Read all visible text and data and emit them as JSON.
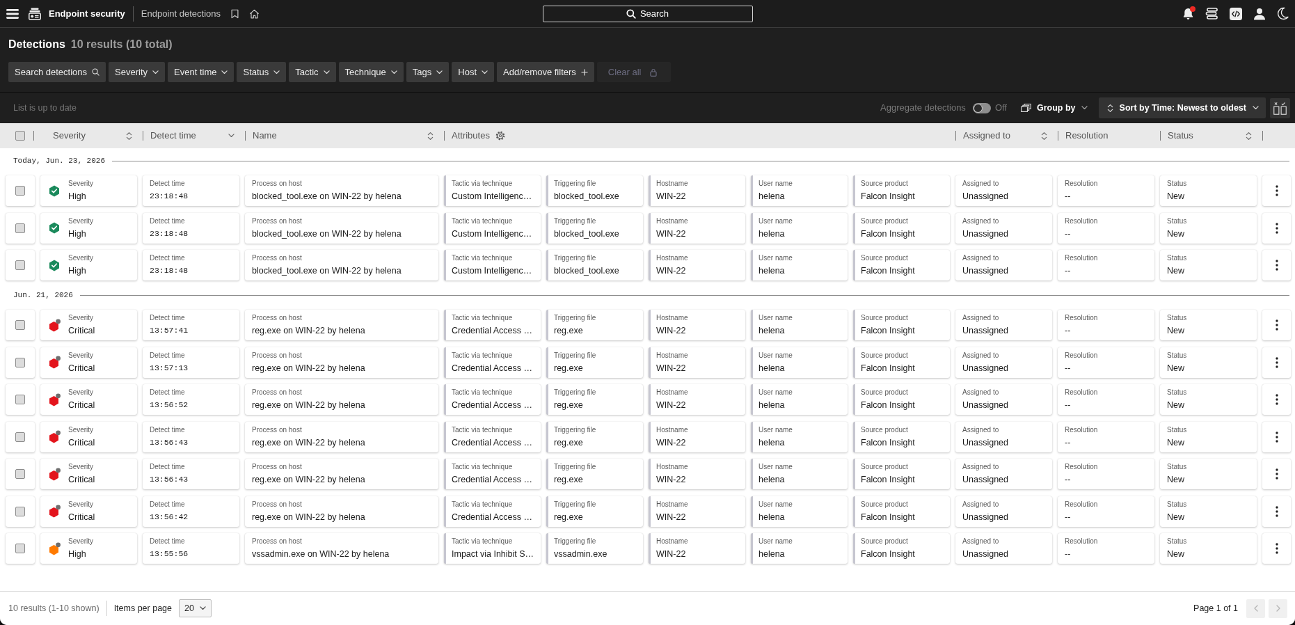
{
  "top_bar": {
    "app_name": "Endpoint security",
    "page_name": "Endpoint detections",
    "search_label": "Search",
    "notifications_unread": true
  },
  "heading": {
    "title": "Detections",
    "count": "10 results (10 total)"
  },
  "filters": [
    {
      "label": "Search detections",
      "kind": "search",
      "disabled": false
    },
    {
      "label": "Severity",
      "kind": "dropdown",
      "disabled": false
    },
    {
      "label": "Event time",
      "kind": "dropdown",
      "disabled": false
    },
    {
      "label": "Status",
      "kind": "dropdown",
      "disabled": false
    },
    {
      "label": "Tactic",
      "kind": "dropdown",
      "disabled": false
    },
    {
      "label": "Technique",
      "kind": "dropdown",
      "disabled": false
    },
    {
      "label": "Tags",
      "kind": "dropdown",
      "disabled": false
    },
    {
      "label": "Host",
      "kind": "dropdown",
      "disabled": false
    },
    {
      "label": "Add/remove filters",
      "kind": "add",
      "disabled": false
    },
    {
      "label": "Clear all",
      "kind": "clear",
      "disabled": true
    }
  ],
  "toolbar": {
    "list_status": "List is up to date",
    "aggregate": {
      "label": "Aggregate detections",
      "on": false,
      "state_text": "Off"
    },
    "group_by": "Group by",
    "sort": "Sort by Time: Newest to oldest"
  },
  "table": {
    "select_all_checked": false,
    "columns": [
      {
        "label": "Severity",
        "kind": "sortable"
      },
      {
        "label": "Detect time",
        "kind": "sorted"
      },
      {
        "label": "Name",
        "kind": "sortable"
      },
      {
        "label": "Attributes",
        "kind": "attributes"
      },
      {
        "label": "Assigned to",
        "kind": "sortable"
      },
      {
        "label": "Resolution",
        "kind": "plain"
      },
      {
        "label": "Status",
        "kind": "sortable"
      }
    ],
    "groups": [
      {
        "date": "Today, Jun. 23, 2026",
        "rows": [
          {
            "selected": false,
            "fields": [
              {
                "kind": "severity",
                "label": "Severity",
                "value": "High",
                "color": "#1b8a5c",
                "prevented": true
              },
              {
                "kind": "time",
                "label": "Detect time",
                "value": "23:18:48"
              },
              {
                "kind": "plain",
                "label": "Process on host",
                "value": "blocked_tool.exe on WIN-22 by helena"
              },
              {
                "kind": "attribute",
                "label": "Tactic via technique",
                "value": "Custom Intelligenc…"
              },
              {
                "kind": "attribute",
                "label": "Triggering file",
                "value": "blocked_tool.exe"
              },
              {
                "kind": "attribute",
                "label": "Hostname",
                "value": "WIN-22"
              },
              {
                "kind": "attribute",
                "label": "User name",
                "value": "helena"
              },
              {
                "kind": "attribute",
                "label": "Source product",
                "value": "Falcon Insight"
              },
              {
                "kind": "plain",
                "label": "Assigned to",
                "value": "Unassigned"
              },
              {
                "kind": "plain",
                "label": "Resolution",
                "value": "--"
              },
              {
                "kind": "plain",
                "label": "Status",
                "value": "New"
              }
            ]
          },
          {
            "selected": false,
            "fields": [
              {
                "kind": "severity",
                "label": "Severity",
                "value": "High",
                "color": "#1b8a5c",
                "prevented": true
              },
              {
                "kind": "time",
                "label": "Detect time",
                "value": "23:18:48"
              },
              {
                "kind": "plain",
                "label": "Process on host",
                "value": "blocked_tool.exe on WIN-22 by helena"
              },
              {
                "kind": "attribute",
                "label": "Tactic via technique",
                "value": "Custom Intelligenc…"
              },
              {
                "kind": "attribute",
                "label": "Triggering file",
                "value": "blocked_tool.exe"
              },
              {
                "kind": "attribute",
                "label": "Hostname",
                "value": "WIN-22"
              },
              {
                "kind": "attribute",
                "label": "User name",
                "value": "helena"
              },
              {
                "kind": "attribute",
                "label": "Source product",
                "value": "Falcon Insight"
              },
              {
                "kind": "plain",
                "label": "Assigned to",
                "value": "Unassigned"
              },
              {
                "kind": "plain",
                "label": "Resolution",
                "value": "--"
              },
              {
                "kind": "plain",
                "label": "Status",
                "value": "New"
              }
            ]
          },
          {
            "selected": false,
            "fields": [
              {
                "kind": "severity",
                "label": "Severity",
                "value": "High",
                "color": "#1b8a5c",
                "prevented": true
              },
              {
                "kind": "time",
                "label": "Detect time",
                "value": "23:18:48"
              },
              {
                "kind": "plain",
                "label": "Process on host",
                "value": "blocked_tool.exe on WIN-22 by helena"
              },
              {
                "kind": "attribute",
                "label": "Tactic via technique",
                "value": "Custom Intelligenc…"
              },
              {
                "kind": "attribute",
                "label": "Triggering file",
                "value": "blocked_tool.exe"
              },
              {
                "kind": "attribute",
                "label": "Hostname",
                "value": "WIN-22"
              },
              {
                "kind": "attribute",
                "label": "User name",
                "value": "helena"
              },
              {
                "kind": "attribute",
                "label": "Source product",
                "value": "Falcon Insight"
              },
              {
                "kind": "plain",
                "label": "Assigned to",
                "value": "Unassigned"
              },
              {
                "kind": "plain",
                "label": "Resolution",
                "value": "--"
              },
              {
                "kind": "plain",
                "label": "Status",
                "value": "New"
              }
            ]
          }
        ]
      },
      {
        "date": "Jun. 21, 2026",
        "rows": [
          {
            "selected": false,
            "fields": [
              {
                "kind": "severity",
                "label": "Severity",
                "value": "Critical",
                "color": "#e3141c",
                "prevented": false
              },
              {
                "kind": "time",
                "label": "Detect time",
                "value": "13:57:41"
              },
              {
                "kind": "plain",
                "label": "Process on host",
                "value": "reg.exe on WIN-22 by helena"
              },
              {
                "kind": "attribute",
                "label": "Tactic via technique",
                "value": "Credential Access …"
              },
              {
                "kind": "attribute",
                "label": "Triggering file",
                "value": "reg.exe"
              },
              {
                "kind": "attribute",
                "label": "Hostname",
                "value": "WIN-22"
              },
              {
                "kind": "attribute",
                "label": "User name",
                "value": "helena"
              },
              {
                "kind": "attribute",
                "label": "Source product",
                "value": "Falcon Insight"
              },
              {
                "kind": "plain",
                "label": "Assigned to",
                "value": "Unassigned"
              },
              {
                "kind": "plain",
                "label": "Resolution",
                "value": "--"
              },
              {
                "kind": "plain",
                "label": "Status",
                "value": "New"
              }
            ]
          },
          {
            "selected": false,
            "fields": [
              {
                "kind": "severity",
                "label": "Severity",
                "value": "Critical",
                "color": "#e3141c",
                "prevented": false
              },
              {
                "kind": "time",
                "label": "Detect time",
                "value": "13:57:13"
              },
              {
                "kind": "plain",
                "label": "Process on host",
                "value": "reg.exe on WIN-22 by helena"
              },
              {
                "kind": "attribute",
                "label": "Tactic via technique",
                "value": "Credential Access …"
              },
              {
                "kind": "attribute",
                "label": "Triggering file",
                "value": "reg.exe"
              },
              {
                "kind": "attribute",
                "label": "Hostname",
                "value": "WIN-22"
              },
              {
                "kind": "attribute",
                "label": "User name",
                "value": "helena"
              },
              {
                "kind": "attribute",
                "label": "Source product",
                "value": "Falcon Insight"
              },
              {
                "kind": "plain",
                "label": "Assigned to",
                "value": "Unassigned"
              },
              {
                "kind": "plain",
                "label": "Resolution",
                "value": "--"
              },
              {
                "kind": "plain",
                "label": "Status",
                "value": "New"
              }
            ]
          },
          {
            "selected": false,
            "fields": [
              {
                "kind": "severity",
                "label": "Severity",
                "value": "Critical",
                "color": "#e3141c",
                "prevented": false
              },
              {
                "kind": "time",
                "label": "Detect time",
                "value": "13:56:52"
              },
              {
                "kind": "plain",
                "label": "Process on host",
                "value": "reg.exe on WIN-22 by helena"
              },
              {
                "kind": "attribute",
                "label": "Tactic via technique",
                "value": "Credential Access …"
              },
              {
                "kind": "attribute",
                "label": "Triggering file",
                "value": "reg.exe"
              },
              {
                "kind": "attribute",
                "label": "Hostname",
                "value": "WIN-22"
              },
              {
                "kind": "attribute",
                "label": "User name",
                "value": "helena"
              },
              {
                "kind": "attribute",
                "label": "Source product",
                "value": "Falcon Insight"
              },
              {
                "kind": "plain",
                "label": "Assigned to",
                "value": "Unassigned"
              },
              {
                "kind": "plain",
                "label": "Resolution",
                "value": "--"
              },
              {
                "kind": "plain",
                "label": "Status",
                "value": "New"
              }
            ]
          },
          {
            "selected": false,
            "fields": [
              {
                "kind": "severity",
                "label": "Severity",
                "value": "Critical",
                "color": "#e3141c",
                "prevented": false
              },
              {
                "kind": "time",
                "label": "Detect time",
                "value": "13:56:43"
              },
              {
                "kind": "plain",
                "label": "Process on host",
                "value": "reg.exe on WIN-22 by helena"
              },
              {
                "kind": "attribute",
                "label": "Tactic via technique",
                "value": "Credential Access …"
              },
              {
                "kind": "attribute",
                "label": "Triggering file",
                "value": "reg.exe"
              },
              {
                "kind": "attribute",
                "label": "Hostname",
                "value": "WIN-22"
              },
              {
                "kind": "attribute",
                "label": "User name",
                "value": "helena"
              },
              {
                "kind": "attribute",
                "label": "Source product",
                "value": "Falcon Insight"
              },
              {
                "kind": "plain",
                "label": "Assigned to",
                "value": "Unassigned"
              },
              {
                "kind": "plain",
                "label": "Resolution",
                "value": "--"
              },
              {
                "kind": "plain",
                "label": "Status",
                "value": "New"
              }
            ]
          },
          {
            "selected": false,
            "fields": [
              {
                "kind": "severity",
                "label": "Severity",
                "value": "Critical",
                "color": "#e3141c",
                "prevented": false
              },
              {
                "kind": "time",
                "label": "Detect time",
                "value": "13:56:43"
              },
              {
                "kind": "plain",
                "label": "Process on host",
                "value": "reg.exe on WIN-22 by helena"
              },
              {
                "kind": "attribute",
                "label": "Tactic via technique",
                "value": "Credential Access …"
              },
              {
                "kind": "attribute",
                "label": "Triggering file",
                "value": "reg.exe"
              },
              {
                "kind": "attribute",
                "label": "Hostname",
                "value": "WIN-22"
              },
              {
                "kind": "attribute",
                "label": "User name",
                "value": "helena"
              },
              {
                "kind": "attribute",
                "label": "Source product",
                "value": "Falcon Insight"
              },
              {
                "kind": "plain",
                "label": "Assigned to",
                "value": "Unassigned"
              },
              {
                "kind": "plain",
                "label": "Resolution",
                "value": "--"
              },
              {
                "kind": "plain",
                "label": "Status",
                "value": "New"
              }
            ]
          },
          {
            "selected": false,
            "fields": [
              {
                "kind": "severity",
                "label": "Severity",
                "value": "Critical",
                "color": "#e3141c",
                "prevented": false
              },
              {
                "kind": "time",
                "label": "Detect time",
                "value": "13:56:42"
              },
              {
                "kind": "plain",
                "label": "Process on host",
                "value": "reg.exe on WIN-22 by helena"
              },
              {
                "kind": "attribute",
                "label": "Tactic via technique",
                "value": "Credential Access …"
              },
              {
                "kind": "attribute",
                "label": "Triggering file",
                "value": "reg.exe"
              },
              {
                "kind": "attribute",
                "label": "Hostname",
                "value": "WIN-22"
              },
              {
                "kind": "attribute",
                "label": "User name",
                "value": "helena"
              },
              {
                "kind": "attribute",
                "label": "Source product",
                "value": "Falcon Insight"
              },
              {
                "kind": "plain",
                "label": "Assigned to",
                "value": "Unassigned"
              },
              {
                "kind": "plain",
                "label": "Resolution",
                "value": "--"
              },
              {
                "kind": "plain",
                "label": "Status",
                "value": "New"
              }
            ]
          },
          {
            "selected": false,
            "fields": [
              {
                "kind": "severity",
                "label": "Severity",
                "value": "High",
                "color": "#ff7a00",
                "prevented": false
              },
              {
                "kind": "time",
                "label": "Detect time",
                "value": "13:55:56"
              },
              {
                "kind": "plain",
                "label": "Process on host",
                "value": "vssadmin.exe on WIN-22 by helena"
              },
              {
                "kind": "attribute",
                "label": "Tactic via technique",
                "value": "Impact via Inhibit S…"
              },
              {
                "kind": "attribute",
                "label": "Triggering file",
                "value": "vssadmin.exe"
              },
              {
                "kind": "attribute",
                "label": "Hostname",
                "value": "WIN-22"
              },
              {
                "kind": "attribute",
                "label": "User name",
                "value": "helena"
              },
              {
                "kind": "attribute",
                "label": "Source product",
                "value": "Falcon Insight"
              },
              {
                "kind": "plain",
                "label": "Assigned to",
                "value": "Unassigned"
              },
              {
                "kind": "plain",
                "label": "Resolution",
                "value": "--"
              },
              {
                "kind": "plain",
                "label": "Status",
                "value": "New"
              }
            ]
          }
        ]
      }
    ]
  },
  "footer": {
    "summary": "10 results (1-10 shown)",
    "per_page_label": "Items per page",
    "per_page": "20",
    "page_label": "Page 1 of 1",
    "prev_disabled": true,
    "next_disabled": true
  }
}
